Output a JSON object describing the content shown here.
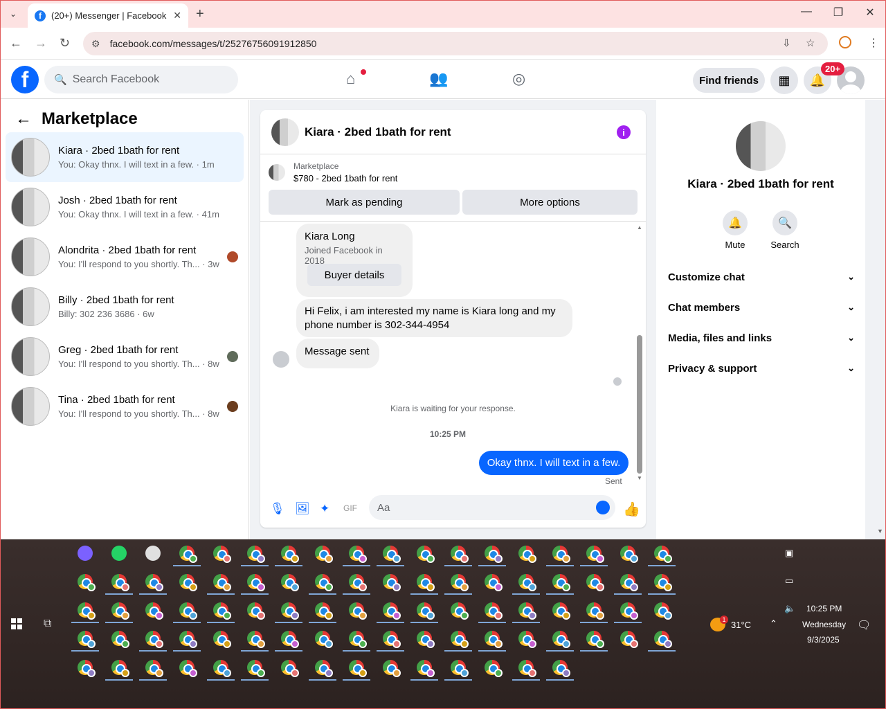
{
  "browser": {
    "tab_title": "(20+) Messenger | Facebook",
    "url": "facebook.com/messages/t/25276756091912850"
  },
  "header": {
    "search_placeholder": "Search Facebook",
    "find_friends": "Find friends",
    "notif_badge": "20+"
  },
  "left": {
    "title": "Marketplace",
    "conversations": [
      {
        "name": "Kiara · 2bed 1bath for rent",
        "preview": "You: Okay thnx. I will text in a few.",
        "time": "1m",
        "selected": true
      },
      {
        "name": "Josh · 2bed 1bath for rent",
        "preview": "You: Okay thnx. I will text in a few.",
        "time": "41m"
      },
      {
        "name": "Alondrita · 2bed 1bath for rent",
        "preview": "You: I'll respond to you shortly. Th...",
        "time": "3w"
      },
      {
        "name": "Billy · 2bed 1bath for rent",
        "preview": "Billy: 302 236 3686",
        "time": "6w"
      },
      {
        "name": "Greg · 2bed 1bath for rent",
        "preview": "You: I'll respond to you shortly. Th...",
        "time": "8w"
      },
      {
        "name": "Tina · 2bed 1bath for rent",
        "preview": "You: I'll respond to you shortly. Th...",
        "time": "8w"
      }
    ]
  },
  "chat": {
    "title": "Kiara · 2bed 1bath for rent",
    "marketplace_label": "Marketplace",
    "listing": "$780 - 2bed 1bath for rent",
    "mark_pending": "Mark as pending",
    "more_options": "More options",
    "buyer_name": "Kiara Long",
    "buyer_joined": "Joined Facebook in 2018",
    "buyer_details": "Buyer details",
    "msg1": "Hi Felix, i am interested my name is Kiara long and my phone number is 302-344-4954",
    "msg2": "Message sent",
    "waiting": "Kiara is waiting for your response.",
    "time": "10:25 PM",
    "outgoing": "Okay thnx. I will text in a few.",
    "sent": "Sent",
    "input_placeholder": "Aa"
  },
  "right": {
    "name": "Kiara · 2bed 1bath for rent",
    "mute": "Mute",
    "search": "Search",
    "sections": [
      "Customize chat",
      "Chat members",
      "Media, files and links",
      "Privacy & support"
    ]
  },
  "taskbar": {
    "temp": "31°C",
    "clock": "10:25 PM",
    "day": "Wednesday",
    "date": "9/3/2025",
    "weather_badge": "1"
  }
}
